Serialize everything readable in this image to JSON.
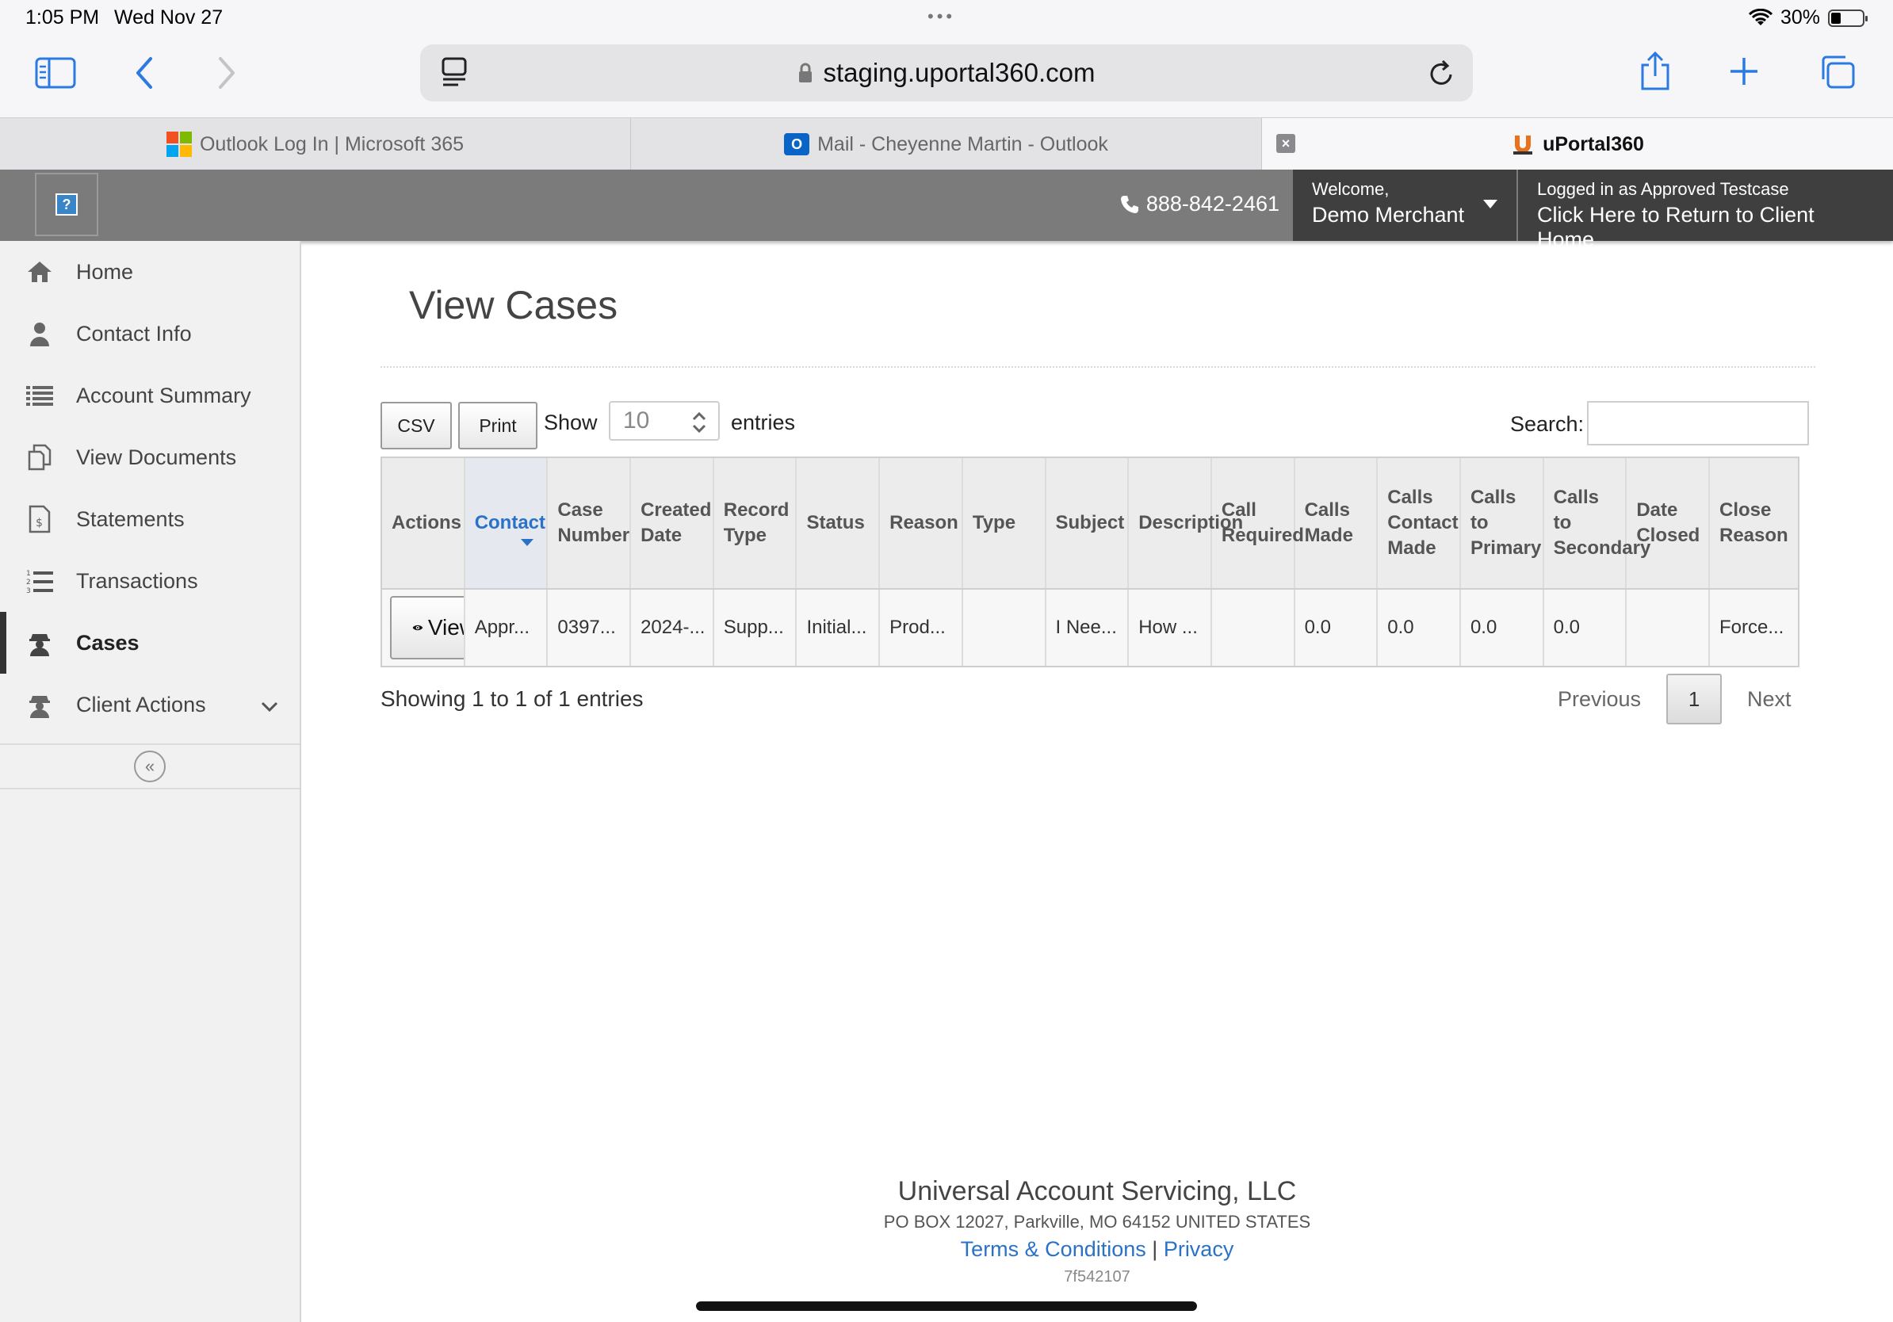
{
  "status_bar": {
    "time": "1:05 PM",
    "date": "Wed Nov 27",
    "battery": "30%"
  },
  "browser": {
    "url": "staging.uportal360.com",
    "tabs": [
      {
        "title": "Outlook Log In | Microsoft 365",
        "icon": "microsoft-logo"
      },
      {
        "title": "Mail - Cheyenne Martin - Outlook",
        "icon": "outlook-logo"
      },
      {
        "title": "uPortal360",
        "icon": "uportal-logo",
        "active": true
      }
    ]
  },
  "header": {
    "phone": "888-842-2461",
    "welcome_label": "Welcome,",
    "user_name": "Demo Merchant",
    "logged_in_label": "Logged in as Approved Testcase",
    "return_link": "Click Here to Return to Client Home"
  },
  "sidebar": {
    "items": [
      {
        "label": "Home",
        "icon": "home-icon"
      },
      {
        "label": "Contact Info",
        "icon": "person-icon"
      },
      {
        "label": "Account Summary",
        "icon": "list-icon"
      },
      {
        "label": "View Documents",
        "icon": "documents-icon"
      },
      {
        "label": "Statements",
        "icon": "statement-icon"
      },
      {
        "label": "Transactions",
        "icon": "numbered-list-icon"
      },
      {
        "label": "Cases",
        "icon": "agent-icon",
        "active": true
      },
      {
        "label": "Client Actions",
        "icon": "agent-icon"
      }
    ]
  },
  "main": {
    "title": "View Cases",
    "csv_label": "CSV",
    "print_label": "Print",
    "show_label": "Show",
    "entries_value": "10",
    "entries_label": "entries",
    "search_label": "Search:",
    "search_value": "",
    "columns": [
      "Actions",
      "Contact",
      "Case\nNumber",
      "Created\nDate",
      "Record\nType",
      "Status",
      "Reason",
      "Type",
      "Subject",
      "Description",
      "Call\nRequired",
      "Calls\nMade",
      "Calls\nContact\nMade",
      "Calls\nto\nPrimary",
      "Calls\nto\nSecondary",
      "Date\nClosed",
      "Close\nReason"
    ],
    "sorted_column": "Contact",
    "rows": [
      {
        "action_label": "View",
        "cells": [
          "Appr...",
          "0397...",
          "2024-...",
          "Supp...",
          "Initial...",
          "Prod...",
          "",
          "I Nee...",
          "How ...",
          "",
          "0.0",
          "0.0",
          "0.0",
          "0.0",
          "",
          "Force..."
        ]
      }
    ],
    "showing_text": "Showing 1 to 1 of 1 entries",
    "pager": {
      "previous": "Previous",
      "current": "1",
      "next": "Next"
    }
  },
  "footer": {
    "company": "Universal Account Servicing, LLC",
    "address": "PO BOX 12027, Parkville, MO 64152 UNITED STATES",
    "terms": "Terms & Conditions",
    "separator": "|",
    "privacy": "Privacy",
    "build": "7f542107"
  },
  "colors": {
    "header_bg": "#7b7b7b",
    "dark_panel": "#3f3f3f",
    "link": "#2a72c8",
    "sidebar_bg": "#f1f1f1"
  }
}
